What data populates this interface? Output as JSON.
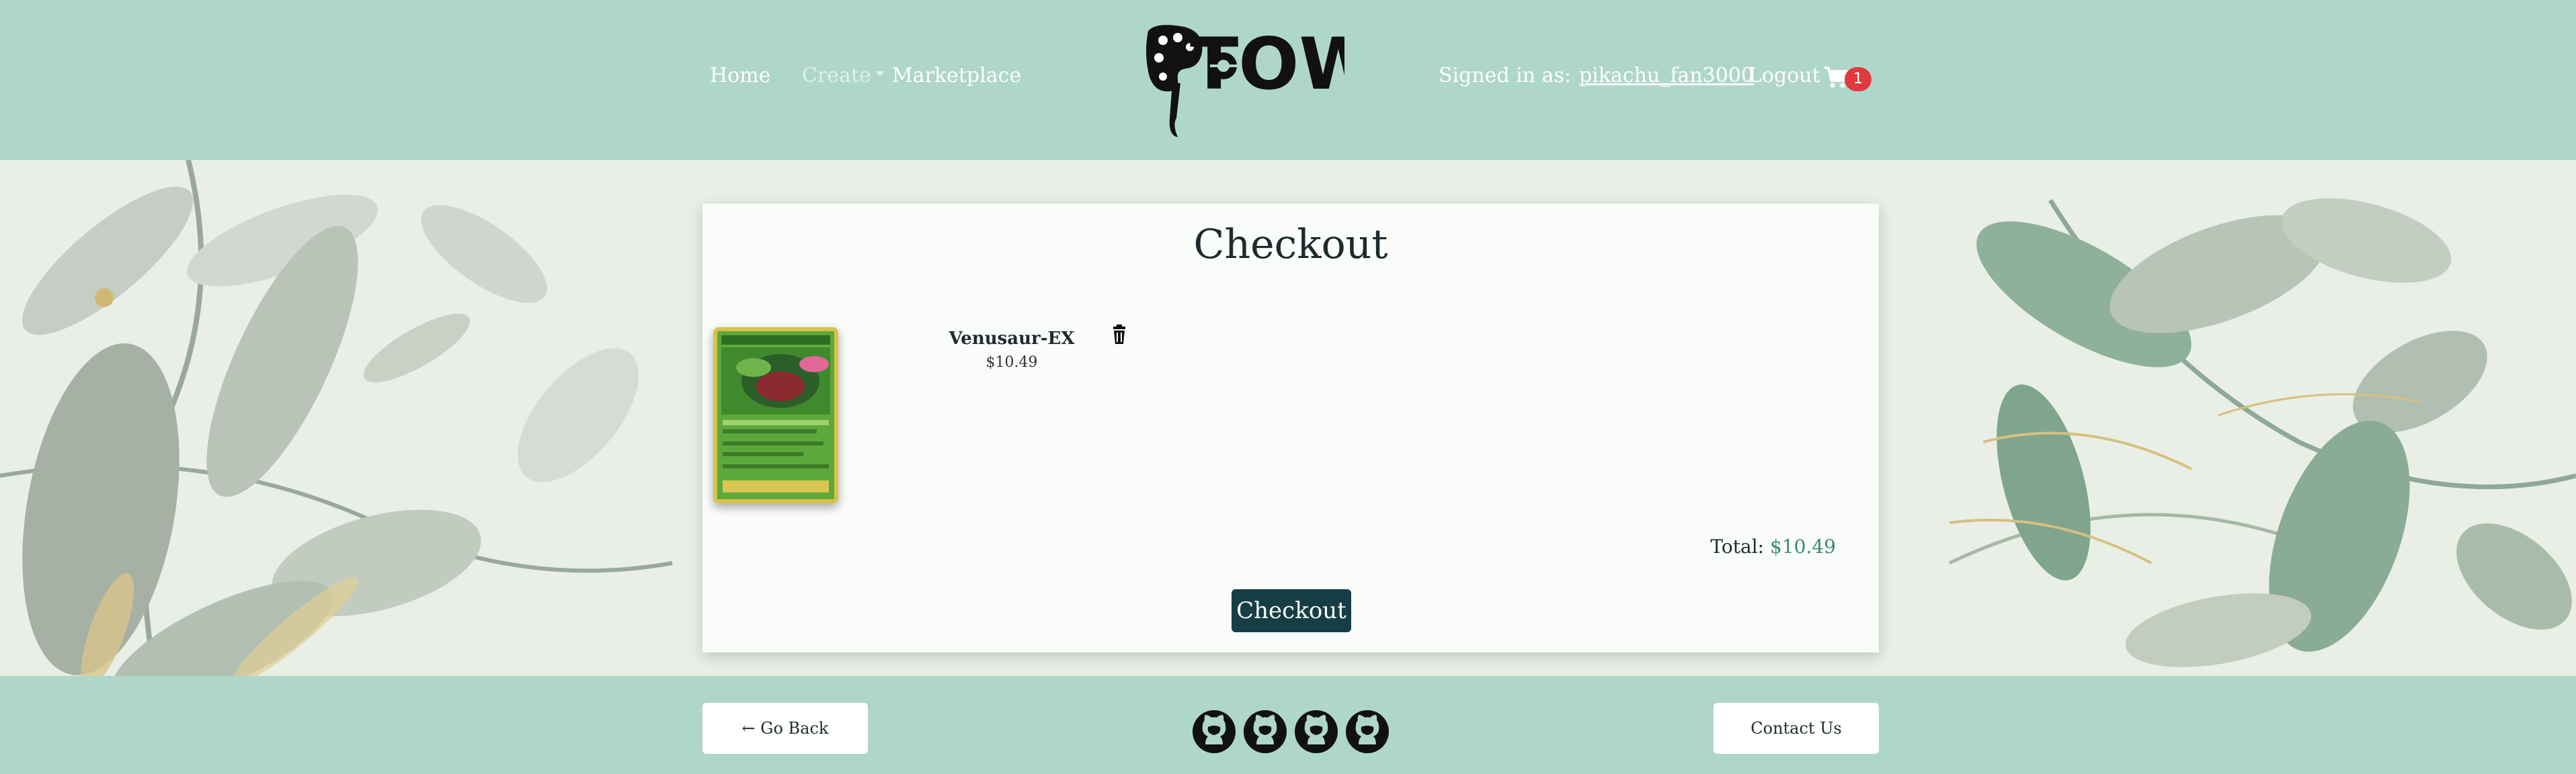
{
  "nav": {
    "home": "Home",
    "create": "Create",
    "marketplace": "Marketplace"
  },
  "logo": {
    "text": "TOWN"
  },
  "user": {
    "signed_in_label": "Signed in as:",
    "username": "pikachu_fan3000",
    "logout": "Logout",
    "cart_count": "1"
  },
  "checkout": {
    "title": "Checkout",
    "items": [
      {
        "name": "Venusaur-EX",
        "price": "$10.49"
      }
    ],
    "total_label": "Total:",
    "total_value": "$10.49",
    "button": "Checkout"
  },
  "footer": {
    "go_back": "← Go Back",
    "contact": "Contact Us"
  },
  "colors": {
    "header_bg": "#afd7c9",
    "checkout_button": "#173e45",
    "total_amount": "#3b8a6e",
    "badge": "#e03a3e"
  },
  "icons": [
    "paintbrush-palette-logo",
    "cart-icon",
    "trash-icon",
    "github-icon"
  ]
}
